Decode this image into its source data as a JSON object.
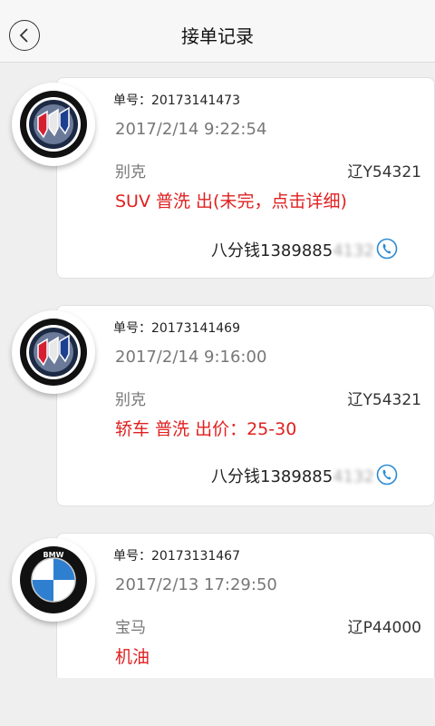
{
  "header": {
    "title": "接单记录"
  },
  "orders": [
    {
      "order_no": "单号：20173141473",
      "time": "2017/2/14 9:22:54",
      "brand": "别克",
      "plate": "辽Y54321",
      "service": "SUV 普洗 出(未完，点击详细)",
      "contact_visible": "八分钱1389885",
      "contact_masked": "4132",
      "logo": "buick-logo"
    },
    {
      "order_no": "单号：20173141469",
      "time": "2017/2/14 9:16:00",
      "brand": "别克",
      "plate": "辽Y54321",
      "service": "轿车 普洗 出价：25-30",
      "contact_visible": "八分钱1389885",
      "contact_masked": "4132",
      "logo": "buick-logo"
    },
    {
      "order_no": "单号：20173131467",
      "time": "2017/2/13 17:29:50",
      "brand": "宝马",
      "plate": "辽P44000",
      "service": "机油",
      "logo": "bmw-logo"
    }
  ],
  "colors": {
    "accent_red": "#e02020",
    "phone_blue": "#2a8ad4"
  },
  "icons": {
    "back": "chevron-left-icon",
    "phone": "phone-icon"
  }
}
